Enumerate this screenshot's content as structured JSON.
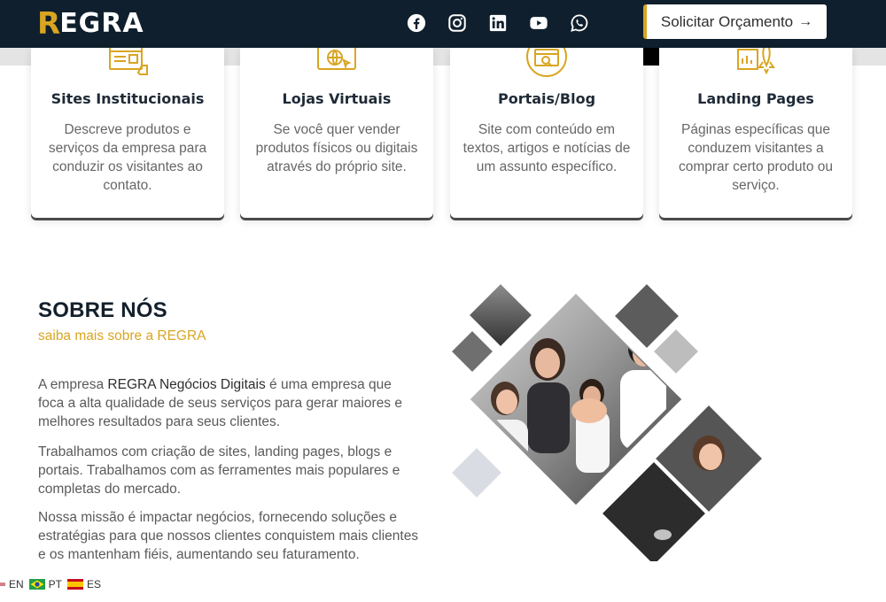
{
  "header": {
    "logo_first_letter": "R",
    "logo_rest": "EGRA",
    "socials": [
      "facebook-icon",
      "instagram-icon",
      "linkedin-icon",
      "youtube-icon",
      "whatsapp-icon"
    ],
    "cta_label": "Solicitar Orçamento",
    "cta_arrow": "→"
  },
  "services": [
    {
      "title": "Sites Institucionais",
      "desc": "Descreve produtos e serviços da empresa para conduzir os visitantes ao contato.",
      "icon": "website-icon"
    },
    {
      "title": "Lojas Virtuais",
      "desc": "Se você quer vender produtos físicos ou digitais através do próprio site.",
      "icon": "online-store-icon"
    },
    {
      "title": "Portais/Blog",
      "desc": "Site com conteúdo em textos, artigos e notícias de um assunto específico.",
      "icon": "portal-search-icon"
    },
    {
      "title": "Landing Pages",
      "desc": "Páginas específicas que conduzem visitantes a comprar certo produto ou serviço.",
      "icon": "rocket-icon"
    }
  ],
  "about": {
    "title": "SOBRE NÓS",
    "subtitle": "saiba mais sobre a REGRA",
    "p1_prefix": "A empresa ",
    "p1_highlight": "REGRA Negócios Digitais",
    "p1_suffix": " é uma empresa que foca a alta qualidade de seus serviços para gerar maiores e melhores resultados para seus clientes.",
    "p2": "Trabalhamos com criação de sites, landing pages, blogs e portais. Trabalhamos com as ferramentes mais populares e completas do mercado.",
    "p3": "Nossa missão é impactar negócios, fornecendo soluções e estratégias para que nossos clientes conquistem mais clientes e os mantenham fiéis, aumentando seu faturamento."
  },
  "languages": [
    {
      "code": "EN",
      "icon": "us-flag-icon"
    },
    {
      "code": "PT",
      "icon": "brazil-flag-icon"
    },
    {
      "code": "ES",
      "icon": "spain-flag-icon"
    }
  ],
  "colors": {
    "header_bg": "#0f1f2d",
    "accent": "#d9a521",
    "heading": "#13202c"
  }
}
